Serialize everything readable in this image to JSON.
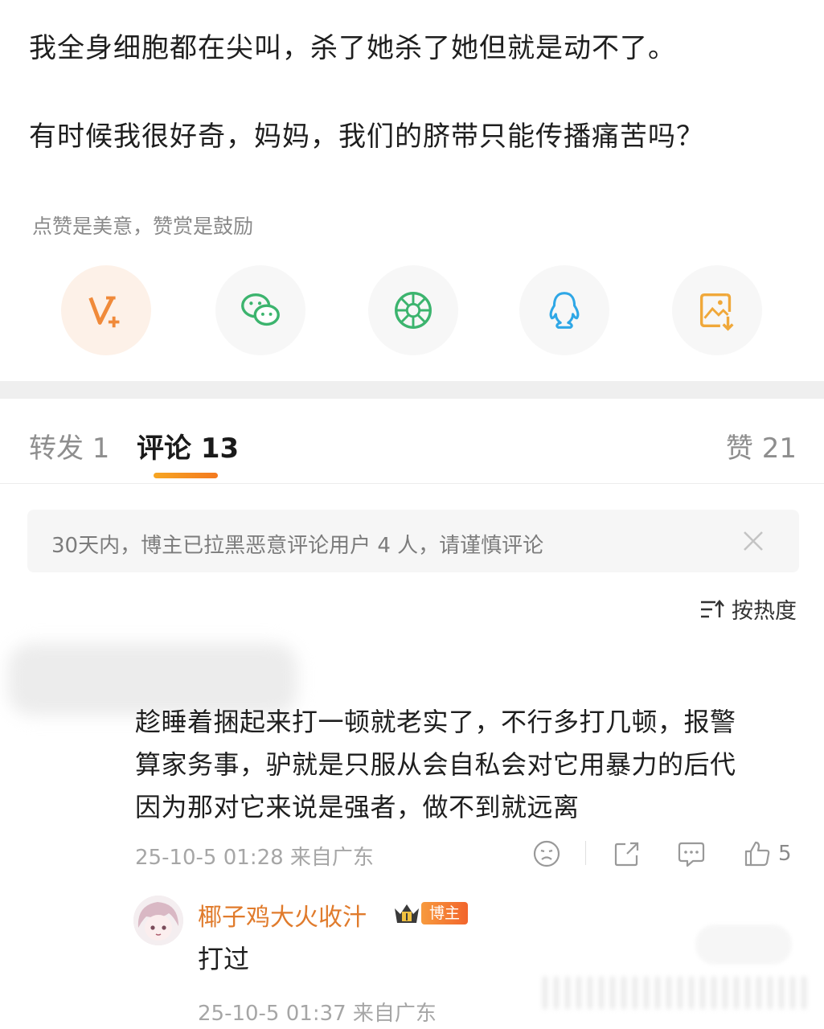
{
  "post": {
    "line1": "我全身细胞都在尖叫，杀了她杀了她但就是动不了。",
    "line2": "有时候我很好奇，妈妈，我们的脐带只能传播痛苦吗？",
    "reward_hint": "点赞是美意，赞赏是鼓励"
  },
  "share": {
    "items": [
      "vplus-icon",
      "wechat-icon",
      "moments-icon",
      "qq-icon",
      "save-image-icon"
    ],
    "colors": {
      "vplus": "#f08a3a",
      "wechat": "#3cb46e",
      "moments": "#3cb46e",
      "qq": "#2fa7e6",
      "save": "#f0a83a"
    }
  },
  "tabs": {
    "repost": "转发 1",
    "comments": "评论 13",
    "likes": "赞 21"
  },
  "notice": {
    "text": "30天内，博主已拉黑恶意评论用户 4 人，请谨慎评论"
  },
  "sort": {
    "label": "按热度"
  },
  "comment": {
    "lines": [
      "趁睡着捆起来打一顿就老实了，不行多打几顿，报警",
      "算家务事，驴就是只服从会自私会对它用暴力的后代",
      "因为那对它来说是强者，做不到就远离"
    ],
    "meta": "25-10-5 01:28 来自广东",
    "like_count": "5"
  },
  "reply": {
    "author": "椰子鸡大火收汁",
    "badge": "博主",
    "text": "打过",
    "meta": "25-10-5 01:37 来自广东"
  },
  "theme": {
    "accent": "#f4791f",
    "author_color": "#e07b2c"
  }
}
